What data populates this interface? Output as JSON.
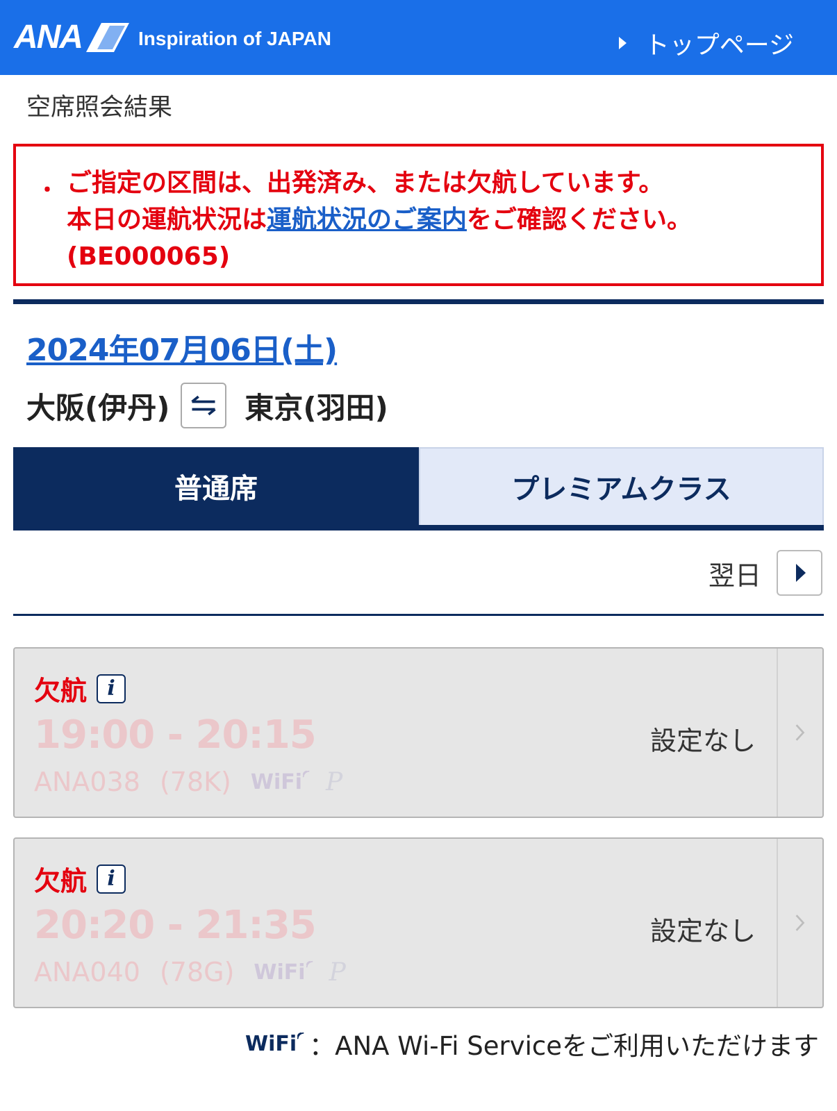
{
  "header": {
    "brand": "ANA",
    "tagline": "Inspiration of JAPAN",
    "top_link": "トップページ"
  },
  "page_title": "空席照会結果",
  "error": {
    "bullet": "・",
    "line1": "ご指定の区間は、出発済み、または欠航しています。",
    "line2_prefix": "本日の運航状況は",
    "line2_link": "運航状況のご案内",
    "line2_suffix": "をご確認ください。",
    "code": "(BE000065)"
  },
  "search": {
    "date": "2024年07月06日(土)",
    "origin": "大阪(伊丹)",
    "destination": "東京(羽田)"
  },
  "tabs": [
    {
      "label": "普通席",
      "active": true
    },
    {
      "label": "プレミアムクラス",
      "active": false
    }
  ],
  "next_day_label": "翌日",
  "flights": [
    {
      "status": "欠航",
      "info_icon": "i",
      "times": "19:00 - 20:15",
      "flight_no": "ANA038",
      "equipment": "(78K)",
      "wifi": "WiFi",
      "premium_mark": "P",
      "seat_status": "設定なし"
    },
    {
      "status": "欠航",
      "info_icon": "i",
      "times": "20:20 - 21:35",
      "flight_no": "ANA040",
      "equipment": "(78G)",
      "wifi": "WiFi",
      "premium_mark": "P",
      "seat_status": "設定なし"
    }
  ],
  "legend": {
    "wifi": "WiFi",
    "text": "：ANA Wi-Fi Serviceをご利用いただけます"
  },
  "colors": {
    "header_blue": "#1a6fe8",
    "navy": "#0c2b5e",
    "error_red": "#e4000f",
    "link_blue": "#1a5fc8"
  }
}
